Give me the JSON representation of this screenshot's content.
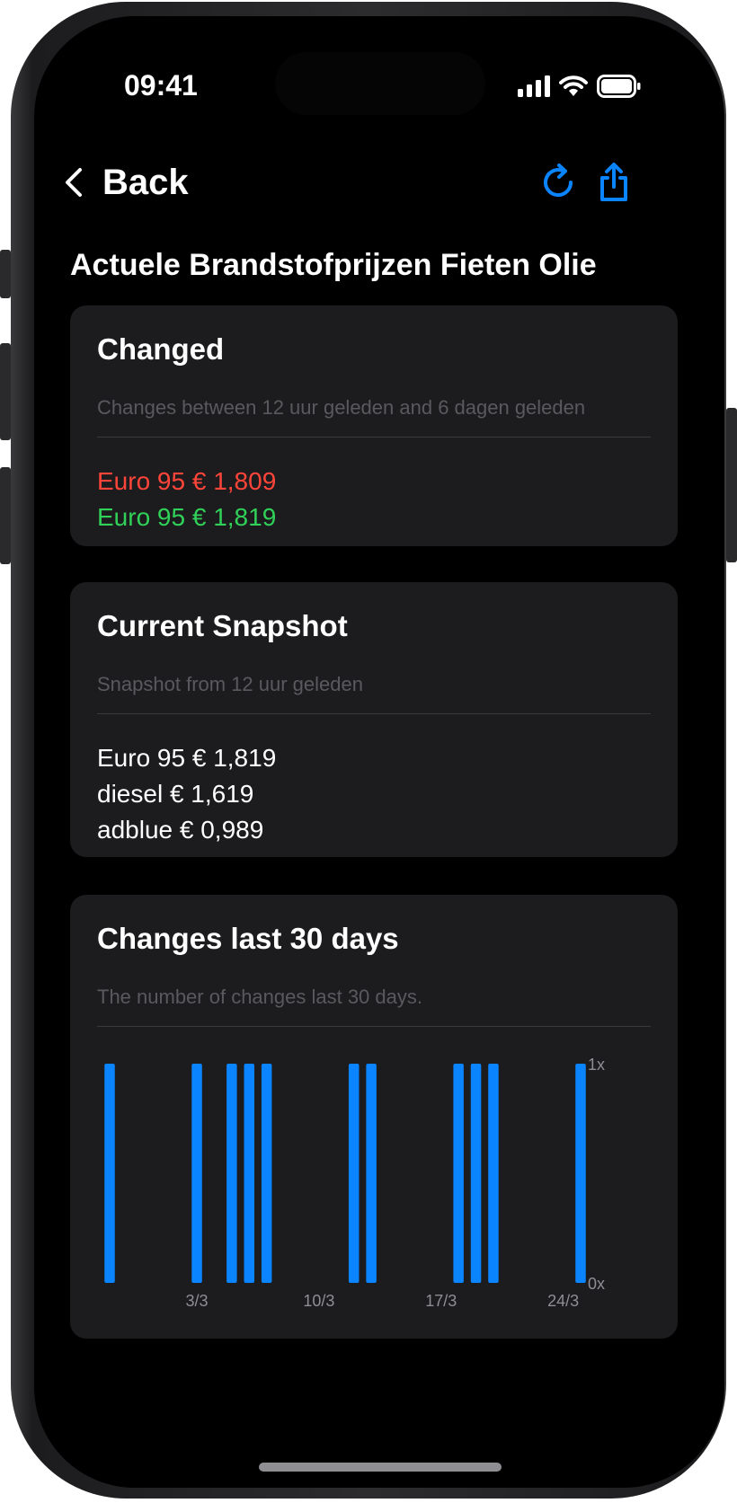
{
  "status_bar": {
    "time": "09:41"
  },
  "nav": {
    "back_label": "Back",
    "refresh_icon": "refresh-icon",
    "share_icon": "share-icon"
  },
  "page": {
    "title": "Actuele Brandstofprijzen Fieten Olie"
  },
  "changed_card": {
    "title": "Changed",
    "subtitle": "Changes between 12 uur geleden and 6 dagen geleden",
    "old_price": "Euro 95 € 1,809",
    "new_price": "Euro 95 € 1,819",
    "old_color": "#ff453a",
    "new_color": "#30d158"
  },
  "snapshot_card": {
    "title": "Current Snapshot",
    "subtitle": "Snapshot from 12 uur geleden",
    "lines": [
      "Euro 95 € 1,819",
      "diesel € 1,619",
      "adblue € 0,989"
    ]
  },
  "changes_card": {
    "title": "Changes last 30 days",
    "subtitle": "The number of changes last 30 days."
  },
  "chart_data": {
    "type": "bar",
    "title": "Changes last 30 days",
    "x_ticks": [
      "3/3",
      "10/3",
      "17/3",
      "24/3"
    ],
    "y_ticks": [
      "1x",
      "0x"
    ],
    "ylim": [
      0,
      1
    ],
    "days": [
      "27/2",
      "28/2",
      "29/2",
      "1/3",
      "2/3",
      "3/3",
      "4/3",
      "5/3",
      "6/3",
      "7/3",
      "8/3",
      "9/3",
      "10/3",
      "11/3",
      "12/3",
      "13/3",
      "14/3",
      "15/3",
      "16/3",
      "17/3",
      "18/3",
      "19/3",
      "20/3",
      "21/3",
      "22/3",
      "23/3",
      "24/3",
      "25/3"
    ],
    "values": [
      1,
      0,
      0,
      0,
      0,
      1,
      0,
      1,
      1,
      1,
      0,
      0,
      0,
      0,
      1,
      1,
      0,
      0,
      0,
      0,
      1,
      1,
      1,
      0,
      0,
      0,
      0,
      1
    ],
    "bar_color": "#0a84ff"
  }
}
